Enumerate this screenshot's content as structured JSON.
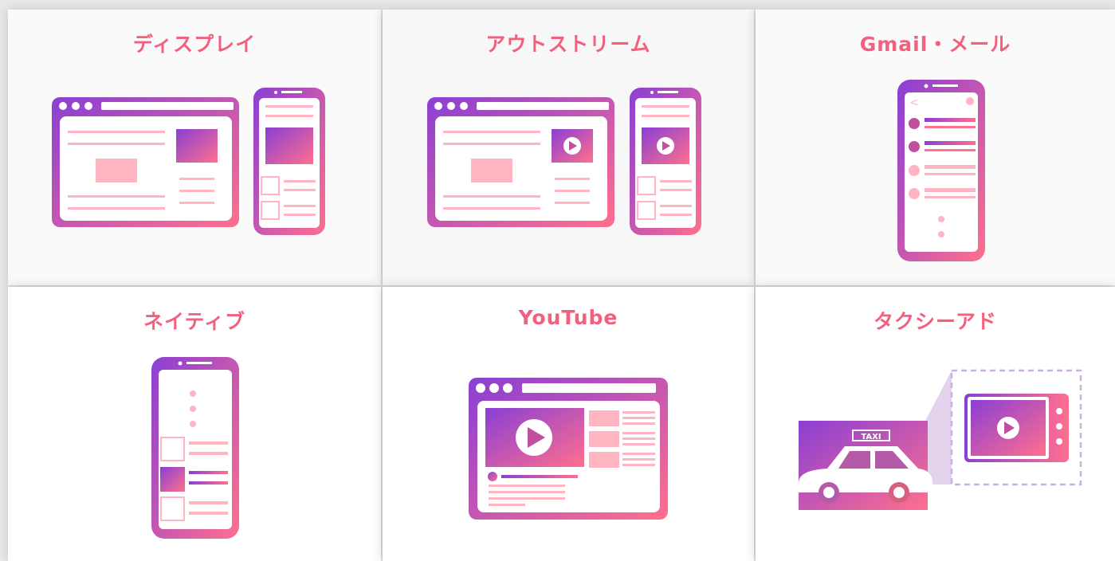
{
  "colors": {
    "title": "#f2607d",
    "gradient_start": "#8a3fd4",
    "gradient_end": "#ff6f8e",
    "accent_light": "#ffb6c2"
  },
  "cards": [
    {
      "title": "ディスプレイ",
      "icon": "display-ad-icon"
    },
    {
      "title": "アウトストリーム",
      "icon": "outstream-video-ad-icon"
    },
    {
      "title": "Gmail・メール",
      "icon": "gmail-mail-ad-icon"
    },
    {
      "title": "ネイティブ",
      "icon": "native-ad-icon"
    },
    {
      "title": "YouTube",
      "icon": "youtube-ad-icon"
    },
    {
      "title": "タクシーアド",
      "icon": "taxi-ad-icon"
    }
  ],
  "taxi_sign": "TAXI"
}
